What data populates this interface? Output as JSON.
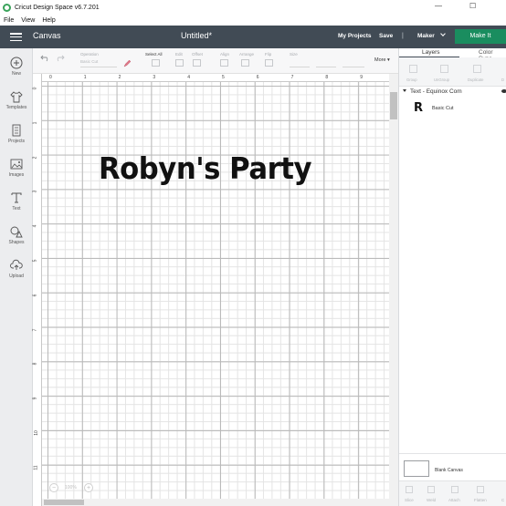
{
  "titlebar": {
    "title": "Cricut Design Space  v6.7.201",
    "controls": {
      "minimize": "—",
      "maximize": "☐"
    }
  },
  "menubar": {
    "items": [
      "File",
      "View",
      "Help"
    ]
  },
  "header": {
    "section": "Canvas",
    "document_title": "Untitled*",
    "my_projects": "My Projects",
    "save": "Save",
    "separator": "|",
    "machine": "Maker",
    "make_it": "Make It"
  },
  "leftrail": {
    "items": [
      {
        "label": "New",
        "icon": "plus-circle-icon"
      },
      {
        "label": "Templates",
        "icon": "shirt-icon"
      },
      {
        "label": "Projects",
        "icon": "projects-icon"
      },
      {
        "label": "Images",
        "icon": "image-icon"
      },
      {
        "label": "Text",
        "icon": "text-t-icon"
      },
      {
        "label": "Shapes",
        "icon": "shapes-icon"
      },
      {
        "label": "Upload",
        "icon": "cloud-upload-icon"
      }
    ]
  },
  "toolbar": {
    "operation_label": "Operation",
    "operation_value": "Basic Cut",
    "select_all": "Select All",
    "edit": "Edit",
    "offset": "Offset",
    "align": "Align",
    "arrange": "Arrange",
    "flip": "Flip",
    "size": "Size",
    "more": "More"
  },
  "rulers": {
    "top": [
      "0",
      "1",
      "2",
      "3",
      "4",
      "5",
      "6",
      "7",
      "8",
      "9"
    ],
    "left": [
      "0",
      "1",
      "2",
      "3",
      "4",
      "5",
      "6",
      "7",
      "8",
      "9",
      "10",
      "11"
    ]
  },
  "canvas": {
    "text_object": "Robyn's Party",
    "zoom_level": "100%",
    "zoom_minus": "−",
    "zoom_plus": "+"
  },
  "rightpanel": {
    "tabs": [
      "Layers",
      "Color Sync"
    ],
    "active_tab": "Layers",
    "layer_tools": [
      "Group",
      "UnGroup",
      "Duplicate",
      "D"
    ],
    "layer_group_name": "Text - Equinox Com",
    "layer_thumb_glyph": "R",
    "layer_item_name": "Basic Cut",
    "blank_canvas": "Blank Canvas",
    "bottom_tools": [
      "Slice",
      "Weld",
      "Attach",
      "Flatten",
      "C"
    ]
  },
  "colors": {
    "header_bg": "#414b55",
    "make_it": "#1a8d5f",
    "app_logo": "#3aa35b"
  }
}
